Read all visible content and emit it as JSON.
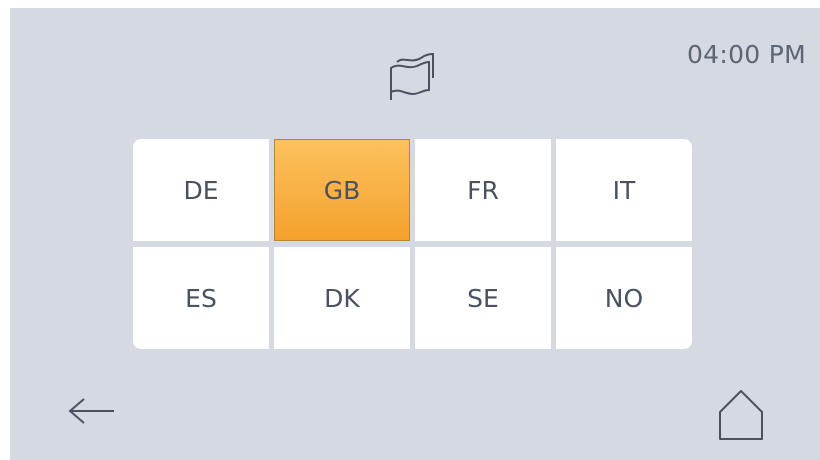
{
  "clock": {
    "time": "04:00 PM"
  },
  "icons": {
    "header": "flag-icon",
    "back": "arrow-left-icon",
    "home": "home-icon"
  },
  "languages": [
    {
      "code": "DE",
      "selected": false
    },
    {
      "code": "GB",
      "selected": true
    },
    {
      "code": "FR",
      "selected": false
    },
    {
      "code": "IT",
      "selected": false
    },
    {
      "code": "ES",
      "selected": false
    },
    {
      "code": "DK",
      "selected": false
    },
    {
      "code": "SE",
      "selected": false
    },
    {
      "code": "NO",
      "selected": false
    }
  ],
  "colors": {
    "background": "#d5d9e1",
    "tile": "#ffffff",
    "selected_top": "#fcc15e",
    "selected_bottom": "#f4a22c",
    "text": "#4a5260"
  }
}
